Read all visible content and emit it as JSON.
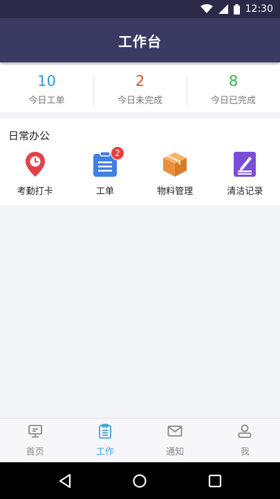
{
  "status": {
    "time": "12:30"
  },
  "header": {
    "title": "工作台"
  },
  "stats": [
    {
      "value": "10",
      "label": "今日工单",
      "color": "#2b9ae0"
    },
    {
      "value": "2",
      "label": "今日未完成",
      "color": "#e8531f"
    },
    {
      "value": "8",
      "label": "今日已完成",
      "color": "#2db84a"
    }
  ],
  "office": {
    "title": "日常办公",
    "items": [
      {
        "label": "考勤打卡",
        "icon": "location-pin-icon"
      },
      {
        "label": "工单",
        "icon": "clipboard-icon",
        "badge": "2"
      },
      {
        "label": "物料管理",
        "icon": "box-icon"
      },
      {
        "label": "清洁记录",
        "icon": "notepad-pen-icon"
      }
    ]
  },
  "tabs": [
    {
      "label": "首页",
      "icon": "monitor-icon",
      "active": false
    },
    {
      "label": "工作",
      "icon": "clipboard-icon",
      "active": true
    },
    {
      "label": "通知",
      "icon": "mail-icon",
      "active": false
    },
    {
      "label": "我",
      "icon": "user-icon",
      "active": false
    }
  ]
}
